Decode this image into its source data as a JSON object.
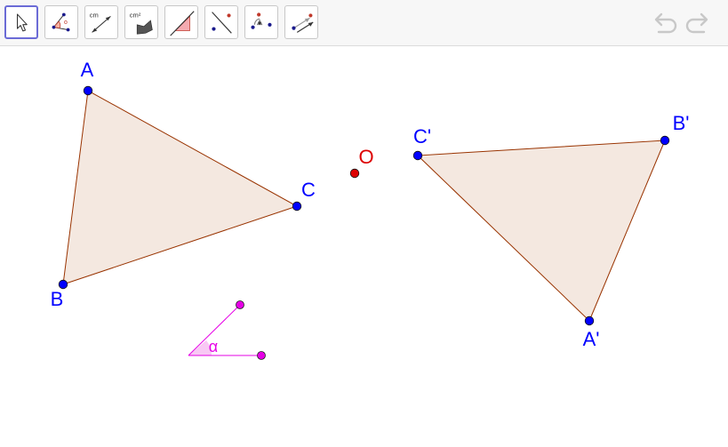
{
  "toolbar": {
    "tools": [
      {
        "name": "move",
        "selected": true,
        "icon": "cursor-arrow-icon"
      },
      {
        "name": "angle",
        "selected": false,
        "icon": "angle-icon"
      },
      {
        "name": "distance",
        "selected": false,
        "icon": "distance-icon",
        "label": "cm"
      },
      {
        "name": "area",
        "selected": false,
        "icon": "area-icon",
        "label": "cm²"
      },
      {
        "name": "slope",
        "selected": false,
        "icon": "slope-icon"
      },
      {
        "name": "reflect-about-line",
        "selected": false,
        "icon": "reflect-line-icon"
      },
      {
        "name": "rotate-around-point",
        "selected": false,
        "icon": "rotate-point-icon"
      },
      {
        "name": "translate-by-vector",
        "selected": false,
        "icon": "translate-vector-icon"
      }
    ],
    "undo_icon": "undo-icon",
    "redo_icon": "redo-icon"
  },
  "drawing": {
    "points": {
      "A": "A",
      "B": "B",
      "C": "C",
      "A_prime": "A'",
      "B_prime": "B'",
      "C_prime": "C'",
      "O": "O"
    },
    "angle_label": "α"
  },
  "colors": {
    "point_blue": "#0000ff",
    "center_red": "#dd0000",
    "polygon_fill": "#f4e8e0",
    "polygon_stroke": "#993300",
    "angle_magenta": "#e600e6",
    "selection_border": "#6b6bd6"
  }
}
